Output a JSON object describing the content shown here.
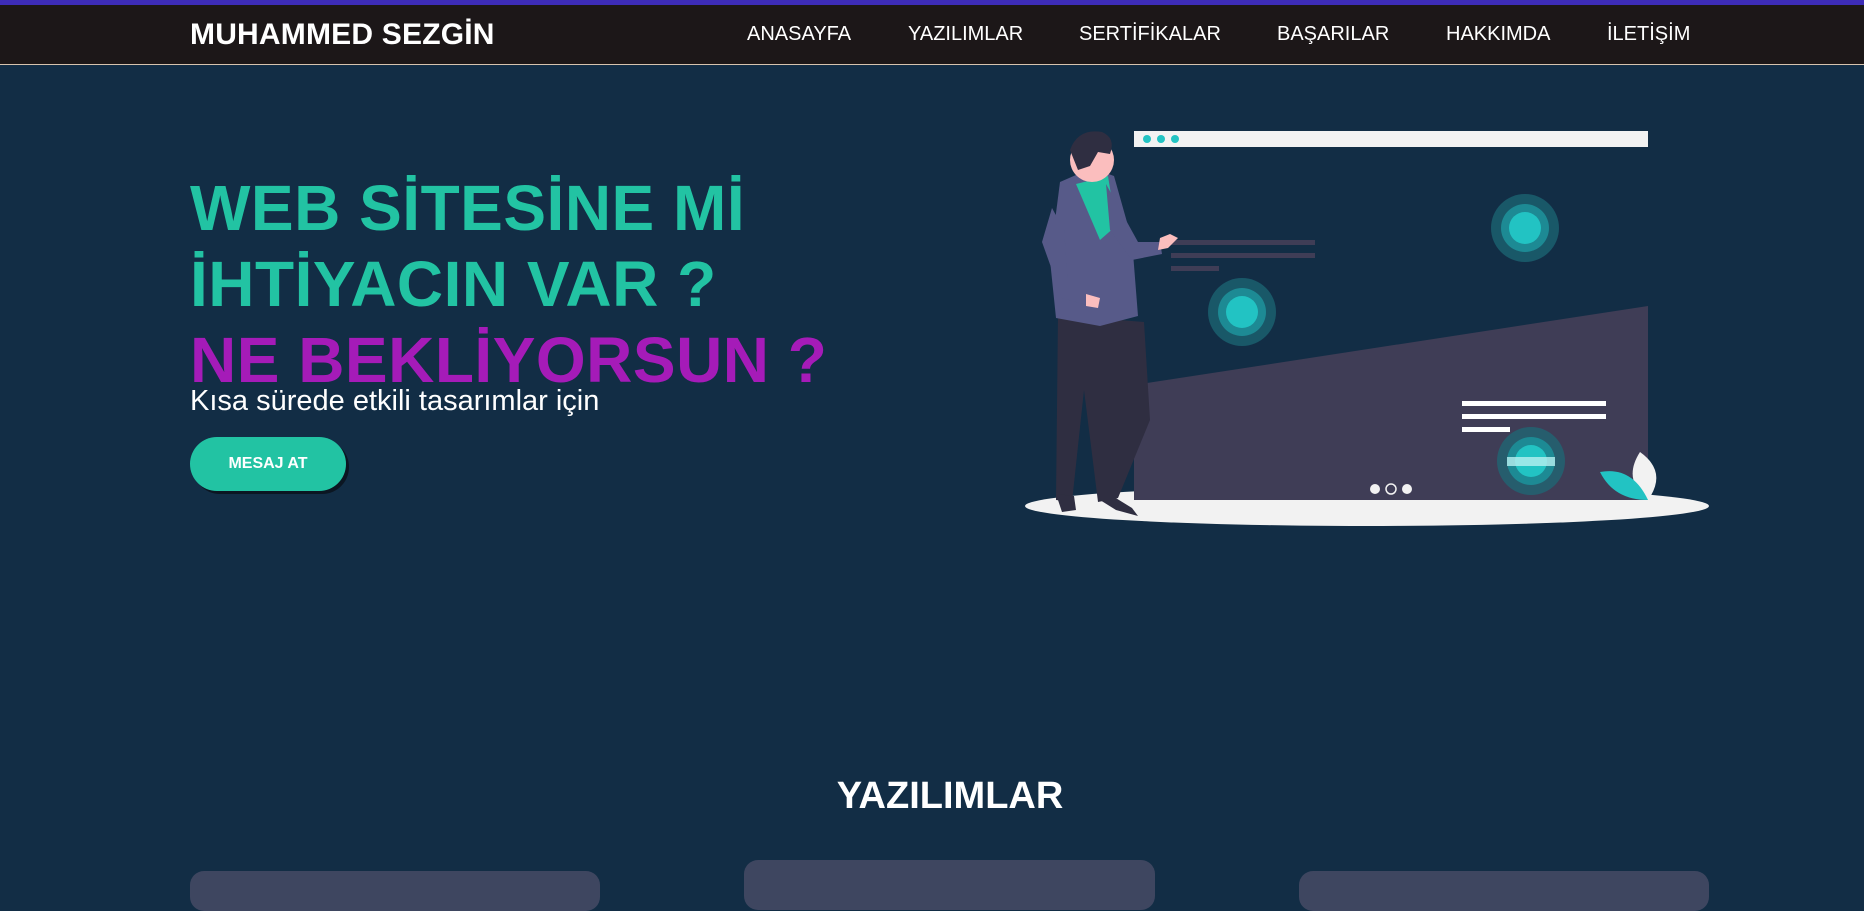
{
  "brand": "MUHAMMED SEZGİN",
  "nav": {
    "items": [
      "ANASAYFA",
      "YAZILIMLAR",
      "SERTİFİKALAR",
      "BAŞARILAR",
      "HAKKIMDA",
      "İLETİŞİM"
    ]
  },
  "hero": {
    "line1": "WEB SİTESİNE Mİ",
    "line2": "İHTİYACIN VAR ?",
    "line3": "NE BEKLİYORSUN ?",
    "subtitle": "Kısa sürede etkili tasarımlar için",
    "cta": "MESAJ AT"
  },
  "section": {
    "title": "YAZILIMLAR"
  },
  "colors": {
    "background": "#122d45",
    "navbar": "#1c1718",
    "accent_bar": "#3d2cb8",
    "teal": "#22c3a3",
    "purple": "#a51bb8",
    "card": "#3e4660"
  },
  "icons": [
    "person-illustration",
    "browser-window-illustration"
  ]
}
